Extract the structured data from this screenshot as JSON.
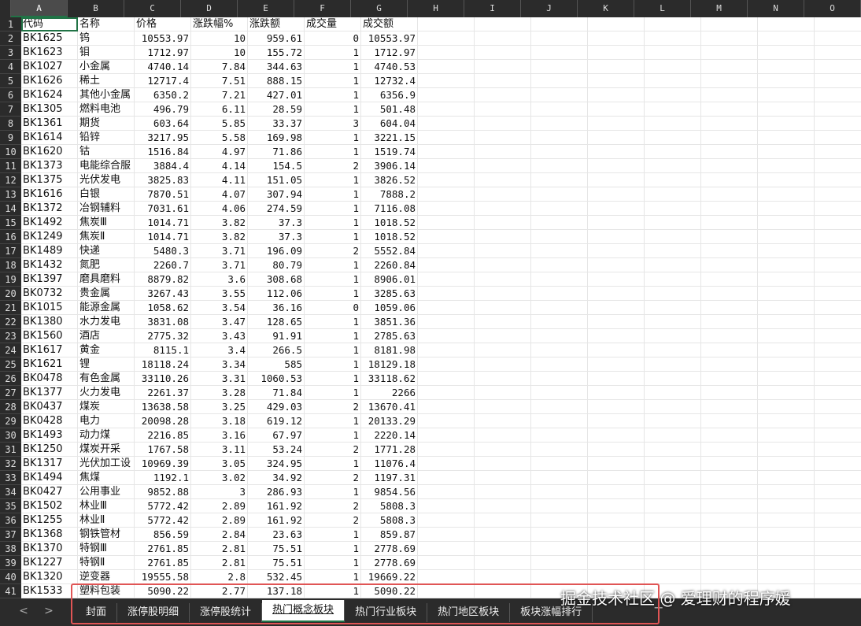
{
  "columns": [
    "A",
    "B",
    "C",
    "D",
    "E",
    "F",
    "G",
    "H",
    "I",
    "J",
    "K",
    "L",
    "M",
    "N",
    "O"
  ],
  "headers": [
    "代码",
    "名称",
    "价格",
    "涨跌幅%",
    "涨跌额",
    "成交量",
    "成交额"
  ],
  "rows": [
    [
      "BK1625",
      "钨",
      "10553.97",
      "10",
      "959.61",
      "0",
      "10553.97"
    ],
    [
      "BK1623",
      "钼",
      "1712.97",
      "10",
      "155.72",
      "1",
      "1712.97"
    ],
    [
      "BK1027",
      "小金属",
      "4740.14",
      "7.84",
      "344.63",
      "1",
      "4740.53"
    ],
    [
      "BK1626",
      "稀土",
      "12717.4",
      "7.51",
      "888.15",
      "1",
      "12732.4"
    ],
    [
      "BK1624",
      "其他小金属",
      "6350.2",
      "7.21",
      "427.01",
      "1",
      "6356.9"
    ],
    [
      "BK1305",
      "燃料电池",
      "496.79",
      "6.11",
      "28.59",
      "1",
      "501.48"
    ],
    [
      "BK1361",
      "期货",
      "603.64",
      "5.85",
      "33.37",
      "3",
      "604.04"
    ],
    [
      "BK1614",
      "铅锌",
      "3217.95",
      "5.58",
      "169.98",
      "1",
      "3221.15"
    ],
    [
      "BK1620",
      "钴",
      "1516.84",
      "4.97",
      "71.86",
      "1",
      "1519.74"
    ],
    [
      "BK1373",
      "电能综合服",
      "3884.4",
      "4.14",
      "154.5",
      "2",
      "3906.14"
    ],
    [
      "BK1375",
      "光伏发电",
      "3825.83",
      "4.11",
      "151.05",
      "1",
      "3826.52"
    ],
    [
      "BK1616",
      "白银",
      "7870.51",
      "4.07",
      "307.94",
      "1",
      "7888.2"
    ],
    [
      "BK1372",
      "冶钢辅料",
      "7031.61",
      "4.06",
      "274.59",
      "1",
      "7116.08"
    ],
    [
      "BK1492",
      "焦炭Ⅲ",
      "1014.71",
      "3.82",
      "37.3",
      "1",
      "1018.52"
    ],
    [
      "BK1249",
      "焦炭Ⅱ",
      "1014.71",
      "3.82",
      "37.3",
      "1",
      "1018.52"
    ],
    [
      "BK1489",
      "快递",
      "5480.3",
      "3.71",
      "196.09",
      "2",
      "5552.84"
    ],
    [
      "BK1432",
      "氮肥",
      "2260.7",
      "3.71",
      "80.79",
      "1",
      "2260.84"
    ],
    [
      "BK1397",
      "磨具磨料",
      "8879.82",
      "3.6",
      "308.68",
      "1",
      "8906.01"
    ],
    [
      "BK0732",
      "贵金属",
      "3267.43",
      "3.55",
      "112.06",
      "1",
      "3285.63"
    ],
    [
      "BK1015",
      "能源金属",
      "1058.62",
      "3.54",
      "36.16",
      "0",
      "1059.06"
    ],
    [
      "BK1380",
      "水力发电",
      "3831.08",
      "3.47",
      "128.65",
      "1",
      "3851.36"
    ],
    [
      "BK1560",
      "酒店",
      "2775.32",
      "3.43",
      "91.91",
      "1",
      "2785.63"
    ],
    [
      "BK1617",
      "黄金",
      "8115.1",
      "3.4",
      "266.5",
      "1",
      "8181.98"
    ],
    [
      "BK1621",
      "锂",
      "18118.24",
      "3.34",
      "585",
      "1",
      "18129.18"
    ],
    [
      "BK0478",
      "有色金属",
      "33110.26",
      "3.31",
      "1060.53",
      "1",
      "33118.62"
    ],
    [
      "BK1377",
      "火力发电",
      "2261.37",
      "3.28",
      "71.84",
      "1",
      "2266"
    ],
    [
      "BK0437",
      "煤炭",
      "13638.58",
      "3.25",
      "429.03",
      "2",
      "13670.41"
    ],
    [
      "BK0428",
      "电力",
      "20098.28",
      "3.18",
      "619.12",
      "1",
      "20133.29"
    ],
    [
      "BK1493",
      "动力煤",
      "2216.85",
      "3.16",
      "67.97",
      "1",
      "2220.14"
    ],
    [
      "BK1250",
      "煤炭开采",
      "1767.58",
      "3.11",
      "53.24",
      "2",
      "1771.28"
    ],
    [
      "BK1317",
      "光伏加工设",
      "10969.39",
      "3.05",
      "324.95",
      "1",
      "11076.4"
    ],
    [
      "BK1494",
      "焦煤",
      "1192.1",
      "3.02",
      "34.92",
      "2",
      "1197.31"
    ],
    [
      "BK0427",
      "公用事业",
      "9852.88",
      "3",
      "286.93",
      "1",
      "9854.56"
    ],
    [
      "BK1502",
      "林业Ⅲ",
      "5772.42",
      "2.89",
      "161.92",
      "2",
      "5808.3"
    ],
    [
      "BK1255",
      "林业Ⅱ",
      "5772.42",
      "2.89",
      "161.92",
      "2",
      "5808.3"
    ],
    [
      "BK1368",
      "钢铁管材",
      "856.59",
      "2.84",
      "23.63",
      "1",
      "859.87"
    ],
    [
      "BK1370",
      "特钢Ⅲ",
      "2761.85",
      "2.81",
      "75.51",
      "1",
      "2778.69"
    ],
    [
      "BK1227",
      "特钢Ⅱ",
      "2761.85",
      "2.81",
      "75.51",
      "1",
      "2778.69"
    ],
    [
      "BK1320",
      "逆变器",
      "19555.58",
      "2.8",
      "532.45",
      "1",
      "19669.22"
    ],
    [
      "BK1533",
      "塑料包装",
      "5090.22",
      "2.77",
      "137.18",
      "1",
      "5090.22"
    ]
  ],
  "tabs": [
    "封面",
    "涨停股明细",
    "涨停股统计",
    "热门概念板块",
    "热门行业板块",
    "热门地区板块",
    "板块涨幅排行"
  ],
  "active_tab": 3,
  "nav": {
    "prev": "<",
    "next": ">",
    "add": "+"
  },
  "watermark": "掘金技术社区 @ 爱理财的程序媛"
}
